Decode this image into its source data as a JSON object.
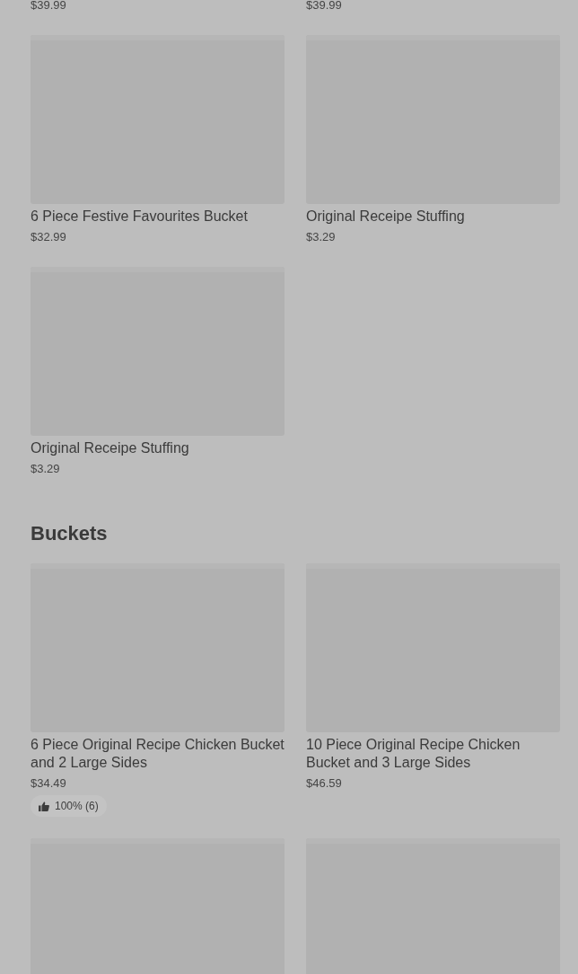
{
  "sections": [
    {
      "products": [
        {
          "price": "$39.99"
        },
        {
          "price": "$39.99"
        },
        {
          "name": "6 Piece Festive Favourites Bucket",
          "price": "$32.99",
          "image": {
            "kind": "picture"
          }
        },
        {
          "name": "Original Receipe Stuffing",
          "price": "$3.29",
          "image": {
            "kind": "picture"
          }
        },
        {
          "name": "Original Receipe Stuffing",
          "price": "$3.29",
          "image": {
            "kind": "picture"
          }
        }
      ]
    },
    {
      "heading": "Buckets",
      "products": [
        {
          "name": "6 Piece Original Recipe Chicken Bucket and 2 Large Sides",
          "price": "$34.49",
          "image": {
            "kind": "picture"
          },
          "rating": "100% (6)"
        },
        {
          "name": "10 Piece Original Recipe Chicken Bucket and 3 Large Sides",
          "price": "$46.59",
          "image": {
            "kind": "picture"
          }
        },
        {
          "image": {
            "kind": "picture"
          }
        },
        {
          "image": {
            "kind": "picture"
          }
        }
      ]
    }
  ]
}
